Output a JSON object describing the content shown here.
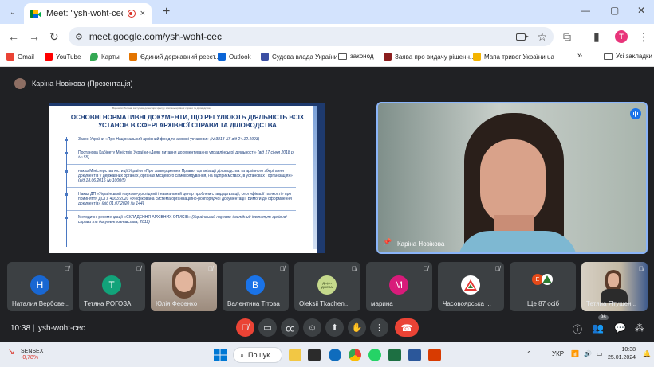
{
  "browser": {
    "tab_title": "Meet: \"ysh-woht-cec\"",
    "tab_close": "×",
    "new_tab": "+",
    "url": "meet.google.com/ysh-woht-cec",
    "profile_initial": "T",
    "window_controls": [
      "—",
      "▢",
      "✕"
    ]
  },
  "bookmarks": [
    {
      "label": "Gmail",
      "color": "#ea4335"
    },
    {
      "label": "YouTube",
      "color": "#ff0000"
    },
    {
      "label": "Карты",
      "color": "#34a853"
    },
    {
      "label": "Єдиний державний реєст...",
      "color": "#e37400"
    },
    {
      "label": "Outlook",
      "color": "#0a64d6"
    },
    {
      "label": "Судова влада України",
      "color": "#3c4fa3"
    },
    {
      "label": "законод",
      "folder": true
    },
    {
      "label": "Заява про видачу рішенн...",
      "color": "#8b1d1d"
    },
    {
      "label": "Мапа тривог України ua",
      "color": "#f4b400"
    },
    {
      "label": "»",
      "color": ""
    },
    {
      "label": "Усі закладки",
      "folder": true
    }
  ],
  "meet": {
    "presenter_label": "Каріна Новікова (Презентація)",
    "slide": {
      "caption": "Ворожбит Тетяна, заступник директора Центру з питань архівної справи та діловодства",
      "title": "ОСНОВНІ НОРМАТИВНІ ДОКУМЕНТИ, ЩО РЕГУЛЮЮТЬ ДІЯЛЬНІСТЬ ВСІХ УСТАНОВ В СФЕРІ АРХІВНОЇ СПРАВИ ТА ДІЛОВОДСТВА",
      "items": [
        {
          "text": "Закон України «Про Національний архівний фонд та архівні установи»",
          "src": "(№3814-ХІІ від 24.12.1993)"
        },
        {
          "text": "Постанова Кабінету Міністрів України «Деякі питання документування управлінської діяльності»",
          "src": "(від 17 січня 2018 р. № 55)"
        },
        {
          "text": "наказ Міністерства юстиції України «Про затвердження Правил організації діловодства та архівного зберігання документів у державних органах, органах місцевого самоврядування, на підприємствах, в установах і організаціях»",
          "src": "(від 18.06.2015 № 1000/5)"
        },
        {
          "text": "Наказ ДП «Український науково-дослідний і навчальний центр проблем стандартизації, сертифікації та якості» про прийняття ДСТУ 4163:2020 «Уніфікована система організаційно-розпорядчої документації. Вимоги до оформлення документів»",
          "src": "(від 01.07.2020 № 144)"
        },
        {
          "text": "Методичні рекомендації «СКЛАДЕННЯ АРХІВНИХ ОПИСІВ»",
          "src": "(Український науково-дослідний інститут архівної справи та документознавства, 2012)"
        }
      ]
    },
    "speaker_name": "Каріна Новікова",
    "participants": [
      {
        "name": "Наталия Вербове...",
        "initial": "Н",
        "color": "#1967d2"
      },
      {
        "name": "Тетяна РОГОЗА",
        "initial": "Т",
        "color": "#12a37a"
      },
      {
        "name": "Юлія Фесенко",
        "initial": "",
        "color": "",
        "video": true
      },
      {
        "name": "Валентина Тітова",
        "initial": "В",
        "color": "#1a73e8"
      },
      {
        "name": "Oleksii Tkachen...",
        "initial": "Дефін ДЖЕЗА",
        "color": "#c5d98c"
      },
      {
        "name": "марина",
        "initial": "М",
        "color": "#d81b7a"
      },
      {
        "name": "Часовоярська ...",
        "initial": "",
        "color": "#ffffff",
        "logo": true
      },
      {
        "name": "Ще 87 осіб",
        "initial": "",
        "color": "",
        "more": true
      },
      {
        "name": "Тетяна Ятушен...",
        "initial": "",
        "color": "",
        "video2": true
      }
    ],
    "more_badge_letter": "E",
    "controls": {
      "time": "10:38",
      "separator": "|",
      "meeting_code": "ysh-woht-cec",
      "participants_count": "96"
    }
  },
  "taskbar": {
    "stock_name": "SENSEX",
    "stock_change": "-0,78%",
    "search_label": "Пошук",
    "tray_lang": "УКР",
    "time": "10:38",
    "date": "25.01.2024"
  }
}
